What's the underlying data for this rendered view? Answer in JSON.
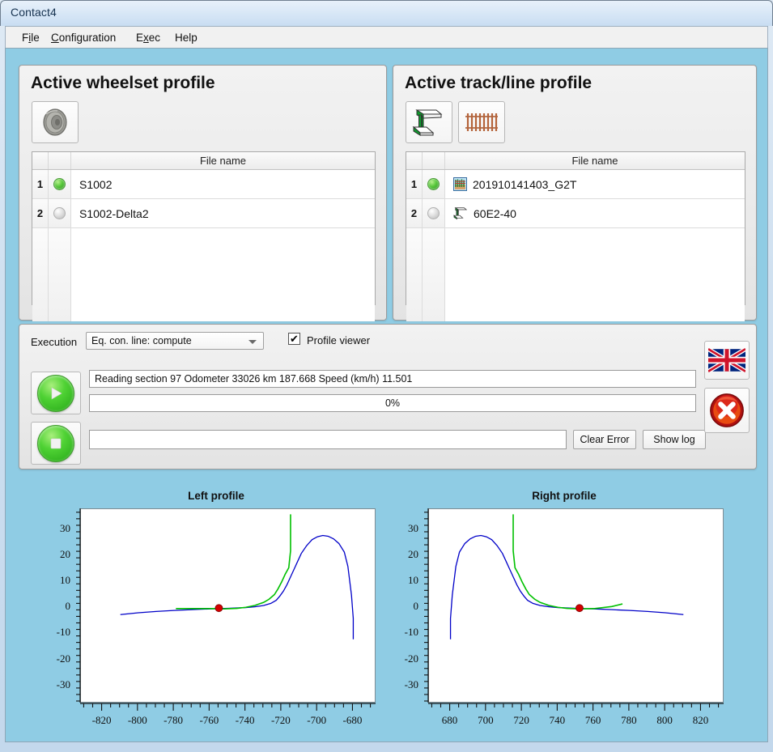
{
  "window": {
    "title": "Contact4"
  },
  "menu": {
    "items": [
      {
        "label": "File",
        "accel": "i"
      },
      {
        "label": "Configuration",
        "accel": "C"
      },
      {
        "label": "Exec",
        "accel": "x"
      },
      {
        "label": "Help",
        "accel": ""
      }
    ]
  },
  "wheelset_panel": {
    "title": "Active wheelset profile",
    "toolbar": [
      {
        "name": "wheel-icon",
        "tooltip": "wheel profile"
      }
    ],
    "table": {
      "header_filename": "File name",
      "rows": [
        {
          "index": "1",
          "active": true,
          "filename": "S1002",
          "icon": ""
        },
        {
          "index": "2",
          "active": false,
          "filename": "S1002-Delta2",
          "icon": ""
        }
      ]
    }
  },
  "track_panel": {
    "title": "Active track/line profile",
    "toolbar": [
      {
        "name": "rail-section-icon",
        "tooltip": "rail profile"
      },
      {
        "name": "track-sleepers-icon",
        "tooltip": "track/line"
      }
    ],
    "table": {
      "header_filename": "File name",
      "rows": [
        {
          "index": "1",
          "active": true,
          "filename": "201910141403_G2T",
          "icon": "measurement-file-icon"
        },
        {
          "index": "2",
          "active": false,
          "filename": "60E2-40",
          "icon": "rail-section-icon"
        }
      ]
    }
  },
  "execution_panel": {
    "label": "Execution",
    "mode_select": {
      "value": "Eq. con. line: compute",
      "options": [
        "Eq. con. line: compute"
      ]
    },
    "profile_viewer": {
      "label": "Profile viewer",
      "checked": true,
      "check_glyph": "✔"
    },
    "status_text": "Reading section 97 Odometer 33026 km 187.668 Speed (km/h) 11.501",
    "progress": {
      "percent_label": "0%",
      "value": 0
    },
    "error_field": "",
    "buttons": {
      "run": "run-button",
      "stop": "stop-button",
      "clear_error": "Clear Error",
      "show_log": "Show log",
      "language": "language-flag-button",
      "error": "error-button"
    }
  },
  "charts": {
    "accent_green": "#00c000",
    "accent_blue": "#0000c8",
    "marker_red": "#d40000",
    "left": {
      "title": "Left profile",
      "chart_data": {
        "type": "line",
        "title": "Left profile",
        "xlabel": "",
        "ylabel": "",
        "xlim": [
          -832,
          -668
        ],
        "ylim": [
          38,
          -36
        ],
        "xticks": [
          -820,
          -800,
          -780,
          -760,
          -740,
          -720,
          -700,
          -680
        ],
        "yticks": [
          -30,
          -20,
          -10,
          0,
          10,
          20,
          30
        ],
        "grid": false,
        "legend": "none",
        "series": [
          {
            "name": "wheel profile",
            "color": "#0000c8",
            "points": [
              [
                -810,
                -2.5
              ],
              [
                -800,
                -1.8
              ],
              [
                -790,
                -1.3
              ],
              [
                -780,
                -0.9
              ],
              [
                -770,
                -0.6
              ],
              [
                -760,
                -0.3
              ],
              [
                -750,
                -0.1
              ],
              [
                -740,
                0.2
              ],
              [
                -735,
                0.5
              ],
              [
                -730,
                1.0
              ],
              [
                -726,
                1.8
              ],
              [
                -723,
                3.0
              ],
              [
                -721,
                4.6
              ],
              [
                -719,
                6.5
              ],
              [
                -717,
                9.0
              ],
              [
                -715,
                12.0
              ],
              [
                -713,
                15.0
              ],
              [
                -711,
                18.0
              ],
              [
                -709,
                21.0
              ],
              [
                -706,
                24.0
              ],
              [
                -703,
                26.3
              ],
              [
                -700,
                27.4
              ],
              [
                -697,
                27.9
              ],
              [
                -694,
                27.6
              ],
              [
                -691,
                26.6
              ],
              [
                -688,
                24.8
              ],
              [
                -685,
                21.5
              ],
              [
                -683,
                16.0
              ],
              [
                -681,
                5.0
              ],
              [
                -680,
                -4.0
              ],
              [
                -680,
                -12.0
              ]
            ]
          },
          {
            "name": "rail profile",
            "color": "#00c000",
            "points": [
              [
                -779,
                -0.2
              ],
              [
                -770,
                -0.2
              ],
              [
                -760,
                -0.2
              ],
              [
                -752,
                -0.3
              ],
              [
                -745,
                -0.1
              ],
              [
                -740,
                0.3
              ],
              [
                -735,
                1.0
              ],
              [
                -730,
                2.2
              ],
              [
                -727,
                3.4
              ],
              [
                -724,
                5.2
              ],
              [
                -722,
                7.4
              ],
              [
                -720,
                10.0
              ],
              [
                -718,
                13.0
              ],
              [
                -716,
                15.5
              ],
              [
                -715,
                22.0
              ],
              [
                -715,
                30.0
              ],
              [
                -715,
                36.0
              ]
            ]
          }
        ],
        "markers": [
          {
            "name": "contact-point",
            "x": -755,
            "y": 0,
            "color": "#d40000"
          }
        ]
      }
    },
    "right": {
      "title": "Right profile",
      "chart_data": {
        "type": "line",
        "title": "Right profile",
        "xlabel": "",
        "ylabel": "",
        "xlim": [
          668,
          832
        ],
        "ylim": [
          38,
          -36
        ],
        "xticks": [
          680,
          700,
          720,
          740,
          760,
          780,
          800,
          820
        ],
        "yticks": [
          -30,
          -20,
          -10,
          0,
          10,
          20,
          30
        ],
        "grid": false,
        "legend": "none",
        "series": [
          {
            "name": "wheel profile",
            "color": "#0000c8",
            "points": [
              [
                680,
                -12.0
              ],
              [
                680,
                -4.0
              ],
              [
                681,
                5.0
              ],
              [
                683,
                16.0
              ],
              [
                685,
                21.5
              ],
              [
                688,
                24.8
              ],
              [
                691,
                26.6
              ],
              [
                694,
                27.6
              ],
              [
                697,
                27.9
              ],
              [
                700,
                27.4
              ],
              [
                703,
                26.3
              ],
              [
                706,
                24.0
              ],
              [
                709,
                21.0
              ],
              [
                711,
                18.0
              ],
              [
                713,
                15.0
              ],
              [
                715,
                12.0
              ],
              [
                717,
                9.0
              ],
              [
                719,
                6.5
              ],
              [
                721,
                4.6
              ],
              [
                723,
                3.0
              ],
              [
                726,
                1.8
              ],
              [
                730,
                1.0
              ],
              [
                735,
                0.5
              ],
              [
                740,
                0.2
              ],
              [
                750,
                -0.1
              ],
              [
                760,
                -0.3
              ],
              [
                770,
                -0.6
              ],
              [
                780,
                -0.9
              ],
              [
                790,
                -1.3
              ],
              [
                800,
                -1.8
              ],
              [
                810,
                -2.5
              ]
            ]
          },
          {
            "name": "rail profile",
            "color": "#00c000",
            "points": [
              [
                715,
                36.0
              ],
              [
                715,
                30.0
              ],
              [
                715,
                22.0
              ],
              [
                716,
                15.5
              ],
              [
                718,
                13.0
              ],
              [
                720,
                10.0
              ],
              [
                722,
                7.4
              ],
              [
                724,
                5.2
              ],
              [
                727,
                3.4
              ],
              [
                730,
                2.2
              ],
              [
                735,
                1.0
              ],
              [
                740,
                0.3
              ],
              [
                745,
                -0.1
              ],
              [
                752,
                -0.3
              ],
              [
                760,
                -0.2
              ],
              [
                770,
                0.6
              ],
              [
                776,
                1.6
              ]
            ]
          }
        ],
        "markers": [
          {
            "name": "contact-point",
            "x": 752,
            "y": 0,
            "color": "#d40000"
          }
        ]
      }
    }
  }
}
